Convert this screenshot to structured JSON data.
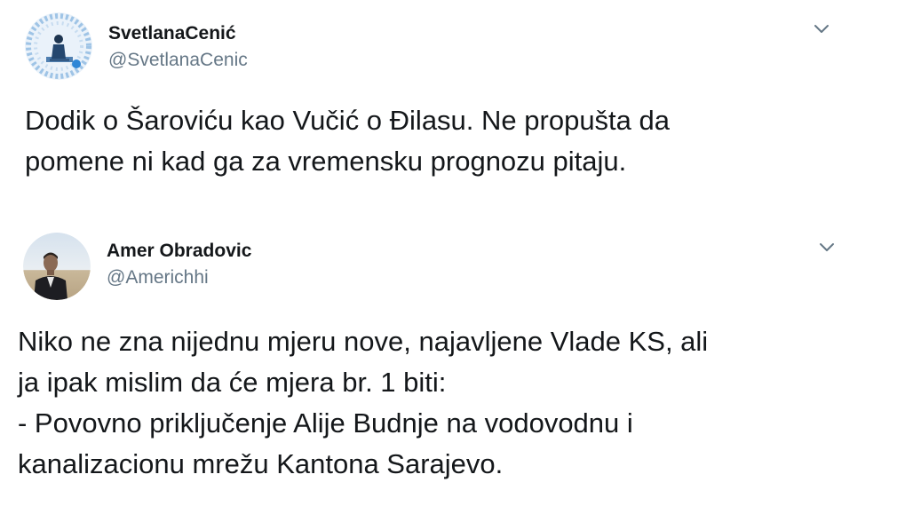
{
  "tweets": [
    {
      "display_name": "SvetlanaCenić",
      "handle": "@SvetlanaCenic",
      "text": "Dodik o Šaroviću kao Vučić o Đilasu. Ne propušta da\npomene ni kad ga za vremensku prognozu pitaju.",
      "avatar_icon": "profile-photo",
      "menu_icon": "chevron-down-icon"
    },
    {
      "display_name": "Amer Obradovic",
      "handle": "@Americhhi",
      "text": "Niko ne zna nijednu mjeru nove, najavljene Vlade KS, ali\nja ipak mislim da će mjera br. 1 biti:\n- Povovno priključenje Alije Budnje na vodovodnu i\nkanalizacionu mrežu Kantona Sarajevo.",
      "avatar_icon": "profile-photo",
      "menu_icon": "chevron-down-icon"
    }
  ],
  "colors": {
    "text": "#14171a",
    "secondary": "#657786",
    "background": "#ffffff"
  }
}
